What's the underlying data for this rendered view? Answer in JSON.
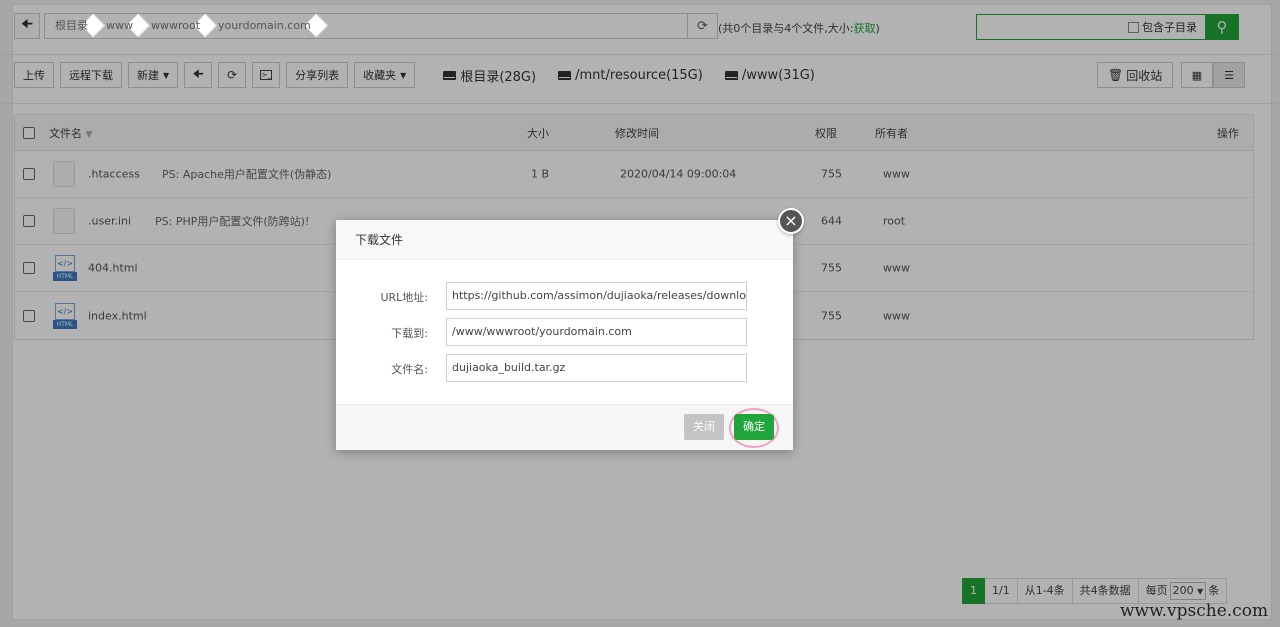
{
  "path": {
    "crumbs": [
      "根目录",
      "www",
      "wwwroot",
      "yourdomain.com"
    ],
    "info_prefix": "(共0个目录与4个文件,大小:",
    "info_link": "获取",
    "info_suffix": ")"
  },
  "search": {
    "include_subdir_label": "包含子目录"
  },
  "toolbar": {
    "upload": "上传",
    "remote_download": "远程下载",
    "new": "新建",
    "share_list": "分享列表",
    "favorites": "收藏夹",
    "recycle": "回收站",
    "disks": [
      "根目录(28G)",
      "/mnt/resource(15G)",
      "/www(31G)"
    ]
  },
  "table": {
    "headers": {
      "name": "文件名",
      "size": "大小",
      "mtime": "修改时间",
      "perm": "权限",
      "owner": "所有者",
      "ops": "操作"
    },
    "rows": [
      {
        "name": ".htaccess",
        "note": "PS: Apache用户配置文件(伪静态)",
        "size": "1 B",
        "mtime": "2020/04/14 09:00:04",
        "perm": "755",
        "owner": "www",
        "type": "file"
      },
      {
        "name": ".user.ini",
        "note": "PS: PHP用户配置文件(防跨站)!",
        "size": "",
        "mtime": "",
        "perm": "644",
        "owner": "root",
        "type": "file"
      },
      {
        "name": "404.html",
        "note": "",
        "size": "",
        "mtime": "",
        "perm": "755",
        "owner": "www",
        "type": "html"
      },
      {
        "name": "index.html",
        "note": "",
        "size": "",
        "mtime": "",
        "perm": "755",
        "owner": "www",
        "type": "html"
      }
    ]
  },
  "modal": {
    "title": "下载文件",
    "url_label": "URL地址:",
    "url_value": "https://github.com/assimon/dujiaoka/releases/downloa",
    "dest_label": "下载到:",
    "dest_value": "/www/wwwroot/yourdomain.com",
    "filename_label": "文件名:",
    "filename_value": "dujiaoka_build.tar.gz",
    "close_btn": "关闭",
    "ok_btn": "确定"
  },
  "pager": {
    "current": "1",
    "pages": "1/1",
    "range": "从1-4条",
    "total": "共4条数据",
    "per_page_prefix": "每页",
    "per_page_value": "200",
    "per_page_suffix": "条"
  },
  "watermark": "www.vpsche.com",
  "colors": {
    "accent": "#20a53a",
    "highlight_ring": "#f2a0c0"
  }
}
